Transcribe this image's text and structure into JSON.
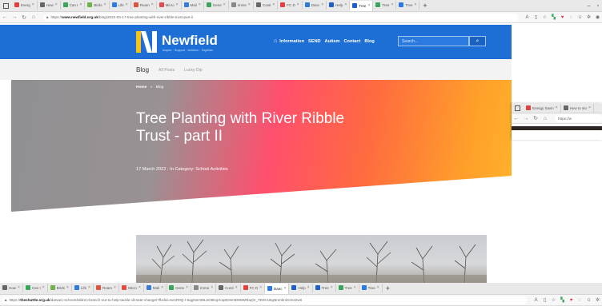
{
  "browser_top": {
    "tabs": [
      {
        "label": "Everg",
        "color": "#e04040"
      },
      {
        "label": "How ",
        "color": "#666666"
      },
      {
        "label": "Can I",
        "color": "#3ba55c"
      },
      {
        "label": "Birds",
        "color": "#6db24a"
      },
      {
        "label": "Life ",
        "color": "#2d7be0"
      },
      {
        "label": "Roam",
        "color": "#e0553d"
      },
      {
        "label": "Micro",
        "color": "#e54b4b"
      },
      {
        "label": "Mail ",
        "color": "#3a7bd5"
      },
      {
        "label": "Gene",
        "color": "#3ba55c"
      },
      {
        "label": "Imme",
        "color": "#888888"
      },
      {
        "label": "Conti",
        "color": "#666666"
      },
      {
        "label": "FC D",
        "color": "#e04040"
      },
      {
        "label": "Danc",
        "color": "#2d7be0"
      },
      {
        "label": "Help",
        "color": "#1f5fc8"
      },
      {
        "label": "Tree",
        "color": "#1f5fc8"
      },
      {
        "label": "Tree",
        "color": "#3ba55c"
      },
      {
        "label": "Tree",
        "color": "#2d7be0"
      }
    ],
    "active_tab_index": 14,
    "url_prefix": "https://",
    "url_host": "www.newfield.org.uk",
    "url_path": "/blog/2022-03-17-tree-planting-with-river-ribble-trust-part-ii"
  },
  "site": {
    "brand": "Newfield",
    "tagline": "Inspire · Support · Achieve · Together",
    "colors": {
      "header": "#1d6fd6",
      "logo_yellow": "#f7c21a",
      "logo_white": "#ffffff"
    },
    "nav": [
      "Information",
      "SEND",
      "Autism",
      "Contact",
      "Blog"
    ],
    "search_placeholder": "Search...",
    "subnav": {
      "title": "Blog",
      "links": [
        "All Posts",
        "Lucky Dip"
      ]
    },
    "breadcrumb": [
      "Home",
      "Blog"
    ],
    "breadcrumb_sep": "»",
    "post_title": "Tree Planting with River Ribble Trust - part II",
    "post_meta": "17 March 2022 - In Category: School Activities"
  },
  "browser_second": {
    "tabs": [
      {
        "label": "Energy Savin",
        "color": "#e04040"
      },
      {
        "label": "How to sto",
        "color": "#666666"
      }
    ],
    "url": "https://w"
  },
  "browser_bottom": {
    "tabs": [
      {
        "label": "How ",
        "color": "#666666"
      },
      {
        "label": "Can I",
        "color": "#3ba55c"
      },
      {
        "label": "Birds",
        "color": "#6db24a"
      },
      {
        "label": "Life ",
        "color": "#2d7be0"
      },
      {
        "label": "Roam",
        "color": "#e0553d"
      },
      {
        "label": "Micro",
        "color": "#e54b4b"
      },
      {
        "label": "Mail ",
        "color": "#3a7bd5"
      },
      {
        "label": "Gene",
        "color": "#3ba55c"
      },
      {
        "label": "Imme",
        "color": "#888888"
      },
      {
        "label": "Conti",
        "color": "#666666"
      },
      {
        "label": "FC D",
        "color": "#e04040"
      },
      {
        "label": "Danc",
        "color": "#2d7be0"
      },
      {
        "label": "Help",
        "color": "#1f5fc8"
      },
      {
        "label": "Tree",
        "color": "#1f5fc8"
      },
      {
        "label": "Tree",
        "color": "#3ba55c"
      },
      {
        "label": "Tree",
        "color": "#2d7be0"
      }
    ],
    "active_tab_index": 11,
    "url_prefix": "https://",
    "url_host": "theshuttle.org.uk",
    "url_path": "/darwen-schoolchildren-branch-out-to-help-tackle-climate-change/?fbclid=IwAR0Q-I-5qgNnmt8L2O851jXoq6OsmtD9MsRbqOr_TE0CUkgNnmbn3CG22w0"
  }
}
